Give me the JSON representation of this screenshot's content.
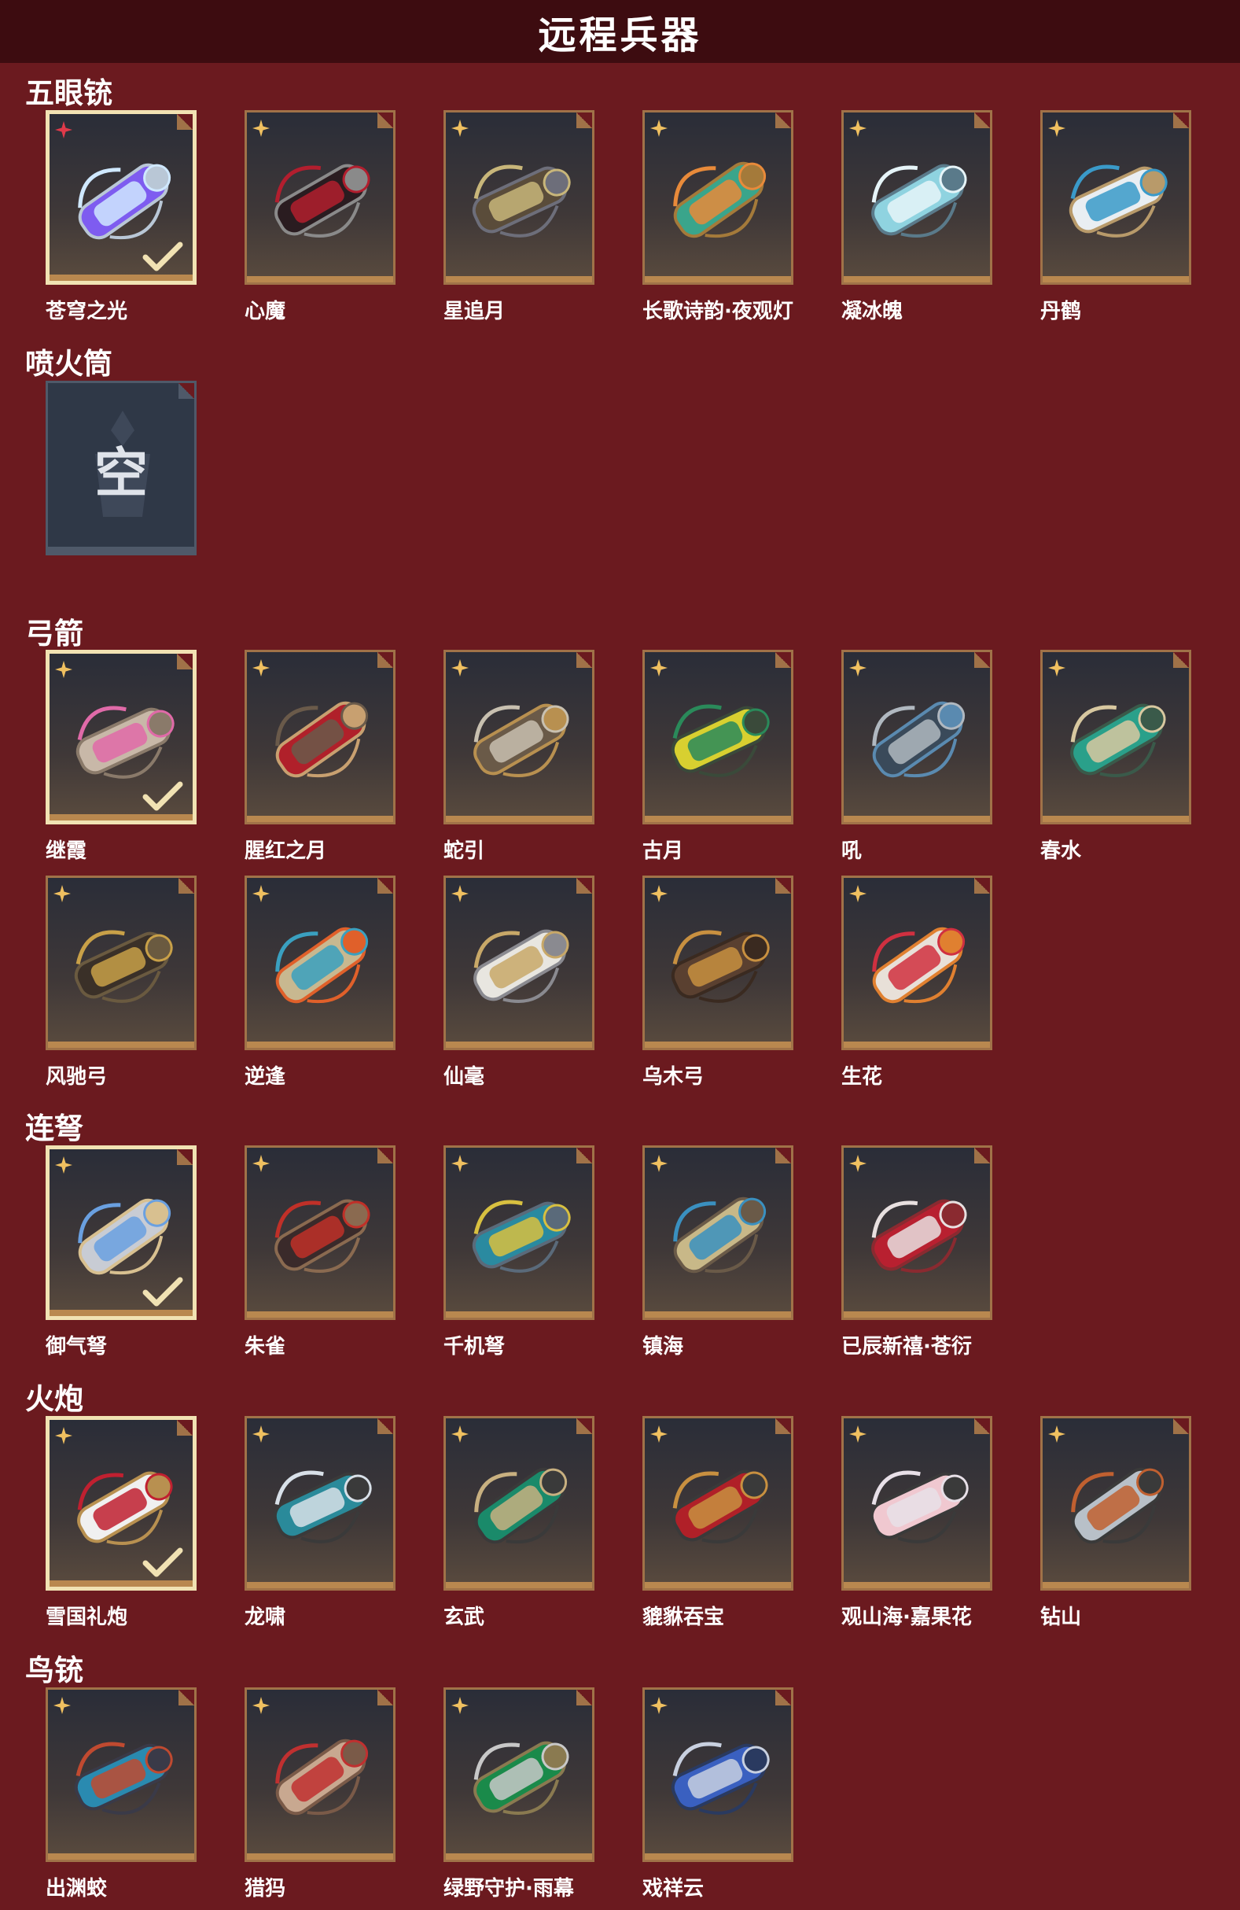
{
  "header": {
    "title": "远程兵器"
  },
  "empty_label": "空",
  "colors": {
    "background": "#6b1a1f",
    "header": "#3d0c10",
    "frame": "#a07248",
    "selected_frame": "#f1e2b3"
  },
  "sections": [
    {
      "title": "五眼铳",
      "items": [
        {
          "name": "苍穹之光",
          "selected": true,
          "rarity": "red",
          "palette": [
            "#7e5cf0",
            "#cfe8ff",
            "#b9c7d6"
          ]
        },
        {
          "name": "心魔",
          "selected": false,
          "rarity": "gold",
          "palette": [
            "#2a1c20",
            "#b21e2e",
            "#8a8a8a"
          ]
        },
        {
          "name": "星追月",
          "selected": false,
          "rarity": "gold",
          "palette": [
            "#5a4c3a",
            "#c8b67a",
            "#6d6e7a"
          ]
        },
        {
          "name": "长歌诗韵·夜观灯",
          "selected": false,
          "rarity": "gold",
          "palette": [
            "#3aa58b",
            "#e88a3a",
            "#a47a3a"
          ]
        },
        {
          "name": "凝冰魄",
          "selected": false,
          "rarity": "gold",
          "palette": [
            "#8fd3e0",
            "#e6f4f8",
            "#5a7a8a"
          ]
        },
        {
          "name": "丹鹤",
          "selected": false,
          "rarity": "gold",
          "palette": [
            "#e9eef2",
            "#3a9ac9",
            "#b89a6a"
          ]
        }
      ]
    },
    {
      "title": "喷火筒",
      "items": [
        {
          "name": "",
          "selected": false,
          "rarity": "none",
          "empty": true
        }
      ]
    },
    {
      "title": "弓箭",
      "items": [
        {
          "name": "继霞",
          "selected": true,
          "rarity": "gold",
          "palette": [
            "#c8b8a8",
            "#e06aa8",
            "#8a7a6a"
          ]
        },
        {
          "name": "腥红之月",
          "selected": false,
          "rarity": "gold",
          "palette": [
            "#b0202a",
            "#6a5a4a",
            "#c8a070"
          ]
        },
        {
          "name": "蛇引",
          "selected": false,
          "rarity": "gold",
          "palette": [
            "#6a5a48",
            "#c8c0b0",
            "#b89050"
          ]
        },
        {
          "name": "古月",
          "selected": false,
          "rarity": "gold",
          "palette": [
            "#d8d030",
            "#2a8a5a",
            "#3a4a3a"
          ]
        },
        {
          "name": "吼",
          "selected": false,
          "rarity": "gold",
          "palette": [
            "#3a4a5a",
            "#b0b8c0",
            "#5a8ab0"
          ]
        },
        {
          "name": "春水",
          "selected": false,
          "rarity": "gold",
          "palette": [
            "#2aa08a",
            "#d8c8a0",
            "#3a5a4a"
          ]
        },
        {
          "name": "风驰弓",
          "selected": false,
          "rarity": "gold",
          "palette": [
            "#3a3028",
            "#c8a048",
            "#6a5a40"
          ]
        },
        {
          "name": "逆逢",
          "selected": false,
          "rarity": "gold",
          "palette": [
            "#c8b890",
            "#3aa0c0",
            "#e0602a"
          ]
        },
        {
          "name": "仙毫",
          "selected": false,
          "rarity": "gold",
          "palette": [
            "#e8e6e0",
            "#c8a868",
            "#8a8a90"
          ]
        },
        {
          "name": "乌木弓",
          "selected": false,
          "rarity": "gold",
          "palette": [
            "#5a4030",
            "#c89040",
            "#3a2a20"
          ]
        },
        {
          "name": "生花",
          "selected": false,
          "rarity": "gold",
          "palette": [
            "#e8e0d8",
            "#d03040",
            "#e08030"
          ]
        }
      ]
    },
    {
      "title": "连弩",
      "items": [
        {
          "name": "御气弩",
          "selected": true,
          "rarity": "gold",
          "palette": [
            "#c8ccd4",
            "#6aa0e0",
            "#d8c090"
          ]
        },
        {
          "name": "朱雀",
          "selected": false,
          "rarity": "gold",
          "palette": [
            "#3a2a2a",
            "#c03028",
            "#8a6a50"
          ]
        },
        {
          "name": "千机弩",
          "selected": false,
          "rarity": "gold",
          "palette": [
            "#2a8aa0",
            "#d8c040",
            "#5a6a7a"
          ]
        },
        {
          "name": "镇海",
          "selected": false,
          "rarity": "gold",
          "palette": [
            "#c8b888",
            "#3a90c0",
            "#6a5a48"
          ]
        },
        {
          "name": "已辰新禧·苍衍",
          "selected": false,
          "rarity": "gold",
          "palette": [
            "#b82030",
            "#e8e0e0",
            "#8a2a30"
          ]
        }
      ]
    },
    {
      "title": "火炮",
      "items": [
        {
          "name": "雪国礼炮",
          "selected": true,
          "rarity": "gold",
          "palette": [
            "#f0f0f0",
            "#c02030",
            "#b89050"
          ]
        },
        {
          "name": "龙啸",
          "selected": false,
          "rarity": "gold",
          "palette": [
            "#2a8a9a",
            "#d8e0e8",
            "#3a3a3a"
          ]
        },
        {
          "name": "玄武",
          "selected": false,
          "rarity": "gold",
          "palette": [
            "#1a8a6a",
            "#c8b080",
            "#3a3a3a"
          ]
        },
        {
          "name": "貔貅吞宝",
          "selected": false,
          "rarity": "gold",
          "palette": [
            "#b02028",
            "#c89040",
            "#3a3a3a"
          ]
        },
        {
          "name": "观山海·嘉果花",
          "selected": false,
          "rarity": "gold",
          "palette": [
            "#f0c8d0",
            "#e8e0e8",
            "#3a3a3a"
          ]
        },
        {
          "name": "钻山",
          "selected": false,
          "rarity": "gold",
          "palette": [
            "#b8c0c8",
            "#c06030",
            "#3a3a3a"
          ]
        }
      ]
    },
    {
      "title": "鸟铳",
      "items": [
        {
          "name": "出渊蛟",
          "selected": false,
          "rarity": "gold",
          "palette": [
            "#2a8ab0",
            "#c04a30",
            "#3a3a48"
          ]
        },
        {
          "name": "猎犸",
          "selected": false,
          "rarity": "gold",
          "palette": [
            "#c8a890",
            "#c03030",
            "#7a5a48"
          ]
        },
        {
          "name": "绿野守护·雨幕",
          "selected": false,
          "rarity": "gold",
          "palette": [
            "#1a8a4a",
            "#c8c8c8",
            "#8a7a50"
          ]
        },
        {
          "name": "戏祥云",
          "selected": false,
          "rarity": "gold",
          "palette": [
            "#3a60c0",
            "#c8d0e0",
            "#2a3a60"
          ]
        }
      ]
    }
  ]
}
